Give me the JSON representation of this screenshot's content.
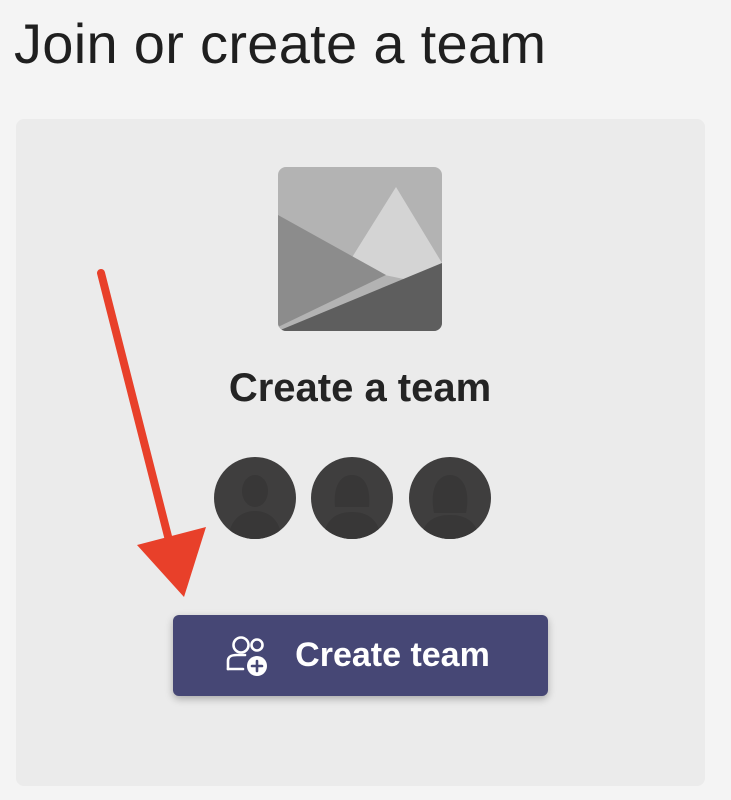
{
  "page": {
    "title": "Join or create a team"
  },
  "card": {
    "title": "Create a team",
    "button_label": "Create team",
    "button_icon": "add-people-icon",
    "image_icon": "image-placeholder-icon",
    "avatars": [
      "person-icon",
      "person-icon",
      "person-icon"
    ]
  },
  "colors": {
    "background": "#f4f4f4",
    "card": "#ebebeb",
    "button": "#464775",
    "annotation_arrow": "#e8402a"
  }
}
